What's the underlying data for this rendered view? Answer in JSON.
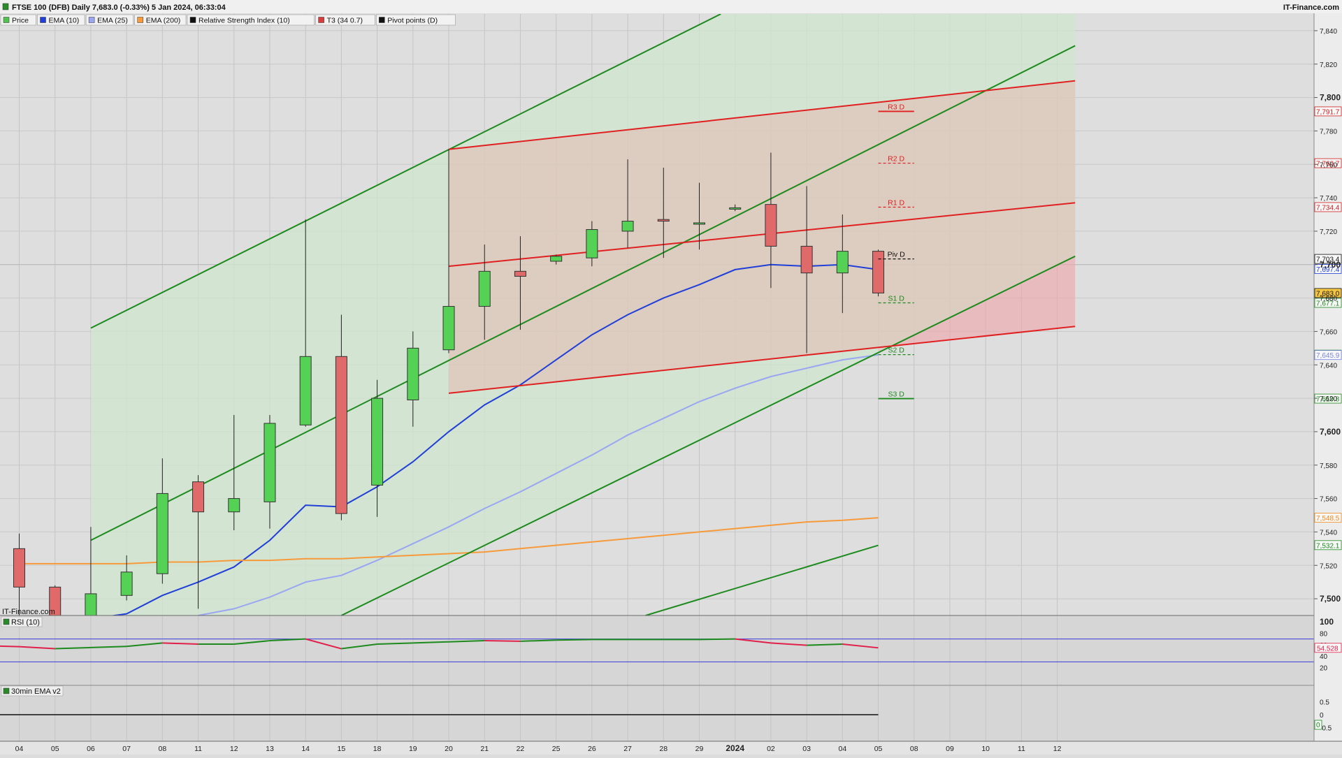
{
  "header": {
    "title": "FTSE 100 (DFB) Daily 7,683.0 (-0.33%) 5 Jan 2024, 06:33:04",
    "brand": "IT-Finance.com"
  },
  "watermark": "IT-Finance.com",
  "legend": [
    {
      "label": "Price",
      "color": "#4fc34f",
      "icon": "price-swatch"
    },
    {
      "label": "EMA (10)",
      "color": "#1f3fd8",
      "icon": "ema10-swatch"
    },
    {
      "label": "EMA (25)",
      "color": "#9aa6f2",
      "icon": "ema25-swatch"
    },
    {
      "label": "EMA (200)",
      "color": "#f79a3a",
      "icon": "ema200-swatch"
    },
    {
      "label": "Relative Strength Index (10)",
      "color": "#111111",
      "icon": "rsi-swatch"
    },
    {
      "label": "T3 (34 0.7)",
      "color": "#d63c3c",
      "icon": "t3-swatch"
    },
    {
      "label": "Pivot points (D)",
      "color": "#111111",
      "icon": "pivot-swatch"
    }
  ],
  "colors": {
    "up": "#55d155",
    "down": "#e06a6a",
    "ema10": "#1f3fd8",
    "ema25": "#9aa6f2",
    "ema200": "#f79a3a",
    "channel_green": "#1c8a1c",
    "channel_red": "#e02020",
    "rsi_up": "#1c8a1c",
    "rsi_down": "#e0204a"
  },
  "chart_data": {
    "type": "candlestick",
    "title": "FTSE 100 (DFB) Daily 7,683.0 (-0.33%) 5 Jan 2024, 06:33:04",
    "ylim": [
      7490,
      7850
    ],
    "y_ticks": [
      7500,
      7520,
      7540,
      7560,
      7580,
      7600,
      7620,
      7640,
      7660,
      7680,
      7700,
      7720,
      7740,
      7760,
      7780,
      7800,
      7820,
      7840
    ],
    "y_tick_labels": [
      "7,500",
      "7,520",
      "7,540",
      "7,560",
      "7,580",
      "7,600",
      "7,620",
      "7,640",
      "7,660",
      "7,680",
      "7,700",
      "7,720",
      "7,740",
      "7,760",
      "7,780",
      "7,800",
      "7,820",
      "7,840"
    ],
    "x_labels": [
      "04",
      "05",
      "06",
      "07",
      "08",
      "11",
      "12",
      "13",
      "14",
      "15",
      "18",
      "19",
      "20",
      "21",
      "22",
      "25",
      "26",
      "27",
      "28",
      "29",
      "2024",
      "02",
      "03",
      "04",
      "05",
      "08",
      "09",
      "10",
      "11",
      "12"
    ],
    "candles": [
      {
        "o": 7530,
        "h": 7539,
        "l": 7490,
        "c": 7507
      },
      {
        "o": 7507,
        "h": 7508,
        "l": 7490,
        "c": 7490
      },
      {
        "o": 7490,
        "h": 7543,
        "l": 7490,
        "c": 7503
      },
      {
        "o": 7502,
        "h": 7526,
        "l": 7499,
        "c": 7516
      },
      {
        "o": 7515,
        "h": 7584,
        "l": 7509,
        "c": 7563
      },
      {
        "o": 7570,
        "h": 7574,
        "l": 7494,
        "c": 7552
      },
      {
        "o": 7552,
        "h": 7610,
        "l": 7541,
        "c": 7560
      },
      {
        "o": 7558,
        "h": 7610,
        "l": 7542,
        "c": 7605
      },
      {
        "o": 7604,
        "h": 7727,
        "l": 7603,
        "c": 7645
      },
      {
        "o": 7645,
        "h": 7670,
        "l": 7547,
        "c": 7551
      },
      {
        "o": 7568,
        "h": 7631,
        "l": 7549,
        "c": 7620
      },
      {
        "o": 7619,
        "h": 7660,
        "l": 7603,
        "c": 7650
      },
      {
        "o": 7649,
        "h": 7769,
        "l": 7647,
        "c": 7675
      },
      {
        "o": 7675,
        "h": 7712,
        "l": 7655,
        "c": 7696
      },
      {
        "o": 7696,
        "h": 7717,
        "l": 7661,
        "c": 7693
      },
      {
        "o": 7702,
        "h": 7706,
        "l": 7700,
        "c": 7705
      },
      {
        "o": 7704,
        "h": 7726,
        "l": 7699,
        "c": 7721
      },
      {
        "o": 7720,
        "h": 7763,
        "l": 7710,
        "c": 7726
      },
      {
        "o": 7727,
        "h": 7758,
        "l": 7704,
        "c": 7726
      },
      {
        "o": 7725,
        "h": 7749,
        "l": 7709,
        "c": 7725
      },
      {
        "o": 7734,
        "h": 7736,
        "l": 7732,
        "c": 7734
      },
      {
        "o": 7736,
        "h": 7767,
        "l": 7686,
        "c": 7711
      },
      {
        "o": 7711,
        "h": 7747,
        "l": 7647,
        "c": 7695
      },
      {
        "o": 7695,
        "h": 7730,
        "l": 7671,
        "c": 7708
      },
      {
        "o": 7708,
        "h": 7709,
        "l": 7681,
        "c": 7683
      }
    ],
    "series": [
      {
        "name": "EMA (10)",
        "values": [
          null,
          null,
          7488,
          7491,
          7502,
          7510,
          7519,
          7535,
          7556,
          7555,
          7567,
          7582,
          7600,
          7616,
          7628,
          7643,
          7658,
          7670,
          7680,
          7688,
          7697,
          7700,
          7699,
          7700,
          7697
        ]
      },
      {
        "name": "EMA (25)",
        "values": [
          null,
          null,
          null,
          null,
          null,
          7490,
          7494,
          7501,
          7510,
          7514,
          7523,
          7533,
          7543,
          7554,
          7564,
          7575,
          7586,
          7598,
          7608,
          7618,
          7626,
          7633,
          7638,
          7643,
          7646
        ]
      },
      {
        "name": "EMA (200)",
        "values": [
          7521,
          7521,
          7521,
          7521,
          7522,
          7522,
          7523,
          7523,
          7524,
          7524,
          7525,
          7526,
          7527,
          7528,
          7530,
          7532,
          7534,
          7536,
          7538,
          7540,
          7542,
          7544,
          7546,
          7547,
          7548.5
        ]
      }
    ],
    "pivots": [
      {
        "label": "R3 D",
        "value": 7791.7
      },
      {
        "label": "R2 D",
        "value": 7760.7
      },
      {
        "label": "R1 D",
        "value": 7734.4
      },
      {
        "label": "Piv D",
        "value": 7703.4
      },
      {
        "label": "S1 D",
        "value": 7677.1
      },
      {
        "label": "S2 D",
        "value": 7646.1
      },
      {
        "label": "S3 D",
        "value": 7619.8
      }
    ],
    "price_tags": [
      {
        "text": "7,791.7",
        "value": 7791.7,
        "color": "#d02020"
      },
      {
        "text": "7,760.7",
        "value": 7760.7,
        "color": "#d02020"
      },
      {
        "text": "7,734.4",
        "value": 7734.4,
        "color": "#d02020"
      },
      {
        "text": "7,703.4",
        "value": 7703.4,
        "color": "#111111"
      },
      {
        "text": "7,697.4",
        "value": 7697.4,
        "color": "#1f3fd8"
      },
      {
        "text": "7,683.0",
        "value": 7683.0,
        "color": "#111111",
        "fill": "#f5c542"
      },
      {
        "text": "7,677.1",
        "value": 7677.1,
        "color": "#1c8a1c"
      },
      {
        "text": "7,646.1",
        "value": 7646.1,
        "color": "#1c8a1c"
      },
      {
        "text": "7,645.9",
        "value": 7645.9,
        "color": "#7a86e0"
      },
      {
        "text": "7,619.8",
        "value": 7619.8,
        "color": "#1c8a1c"
      },
      {
        "text": "7,548.5",
        "value": 7548.5,
        "color": "#f08a1a"
      },
      {
        "text": "7,532.1",
        "value": 7532.1,
        "color": "#1c8a1c"
      }
    ],
    "channels": [
      {
        "name": "green-upper",
        "color": "#1c8a1c",
        "from": [
          2,
          7662
        ],
        "to": [
          19.6,
          7850
        ]
      },
      {
        "name": "green-middle",
        "color": "#1c8a1c",
        "from": [
          2,
          7535
        ],
        "to": [
          29.5,
          7831
        ]
      },
      {
        "name": "green-lower",
        "color": "#1c8a1c",
        "from": [
          9,
          7490
        ],
        "to": [
          29.5,
          7705
        ]
      },
      {
        "name": "green-bottom",
        "color": "#1c8a1c",
        "from": [
          17.5,
          7490
        ],
        "to": [
          24,
          7532
        ]
      },
      {
        "name": "red-upper",
        "color": "#e02020",
        "from": [
          12,
          7769
        ],
        "to": [
          29.5,
          7810
        ]
      },
      {
        "name": "red-middle",
        "color": "#e02020",
        "from": [
          12,
          7699
        ],
        "to": [
          29.5,
          7737
        ]
      },
      {
        "name": "red-lower",
        "color": "#e02020",
        "from": [
          12,
          7623
        ],
        "to": [
          29.5,
          7663
        ]
      }
    ],
    "rsi": {
      "label": "RSI (10)",
      "ylim": [
        0,
        100
      ],
      "y_ticks": [
        20,
        40,
        60,
        80,
        100
      ],
      "y_tick_labels": [
        "20",
        "40",
        "60",
        "80",
        "100"
      ],
      "overbought": 70,
      "oversold": 30,
      "last_text": "54.528",
      "last_value": 54.528,
      "values": [
        56.5,
        53,
        55,
        57,
        63,
        61,
        61,
        67,
        70,
        53,
        61,
        63,
        65,
        67,
        66,
        68,
        69,
        69,
        69,
        69,
        70,
        63,
        59,
        61,
        54.5
      ]
    },
    "ema30": {
      "label": "30min EMA v2",
      "y_ticks": [
        0.5,
        0,
        -0.5
      ],
      "y_tick_labels": [
        "0.5",
        "0",
        "-0.5"
      ],
      "level": 0,
      "last_text": "0"
    }
  }
}
